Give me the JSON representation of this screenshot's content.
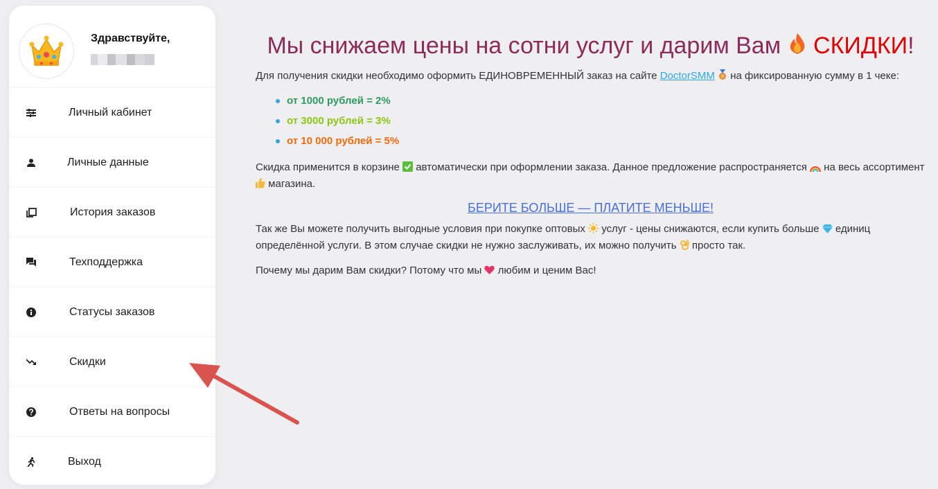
{
  "sidebar": {
    "greeting": "Здравствуйте,",
    "avatar_icon": "crown-icon",
    "items": [
      {
        "label": "Личный кабинет",
        "icon": "sliders-icon"
      },
      {
        "label": "Личные данные",
        "icon": "person-icon"
      },
      {
        "label": "История заказов",
        "icon": "history-icon"
      },
      {
        "label": "Техподдержка",
        "icon": "chat-icon"
      },
      {
        "label": "Статусы заказов",
        "icon": "info-icon"
      },
      {
        "label": "Скидки",
        "icon": "trending-down-icon"
      },
      {
        "label": "Ответы на вопросы",
        "icon": "help-icon"
      },
      {
        "label": "Выход",
        "icon": "running-icon"
      }
    ]
  },
  "main": {
    "title_part1": "Мы снижаем цены на сотни услуг и дарим Вам",
    "title_highlight": "СКИДКИ",
    "title_end": "!",
    "intro_before_link": "Для получения скидки необходимо оформить ЕДИНОВРЕМЕННЫЙ заказ на сайте",
    "link_text": "DoctorSMM",
    "intro_after_link": "на фиксированную сумму в 1 чеке:",
    "tiers": [
      {
        "text": "от 1000 рублей = 2%",
        "color": "#2e9a5e"
      },
      {
        "text": "от 3000 рублей = 3%",
        "color": "#8cc614"
      },
      {
        "text": "от 10 000 рублей = 5%",
        "color": "#f06a0c"
      }
    ],
    "p2_a": "Скидка применится в корзине",
    "p2_b": "автоматически при оформлении заказа. Данное предложение распространяется",
    "p2_c": "на весь ассортимент",
    "p2_d": "магазина.",
    "cta": "БЕРИТЕ БОЛЬШЕ — ПЛАТИТЕ МЕНЬШЕ!",
    "p3_a": "Так же Вы можете получить выгодные условия при покупке оптовых",
    "p3_b": "услуг - цены снижаются, если купить больше",
    "p3_c": "единиц определённой услуги. В этом случае скидки не нужно заслуживать, их можно получить",
    "p3_d": "просто так.",
    "p4_a": "Почему мы дарим Вам скидки? Потому что мы",
    "p4_b": "любим и ценим Вас!"
  },
  "colors": {
    "title": "#8b2c5b",
    "highlight": "#e00000",
    "link": "#2ea7e0",
    "cta": "#4a6fd8",
    "arrow": "#d9534f"
  }
}
